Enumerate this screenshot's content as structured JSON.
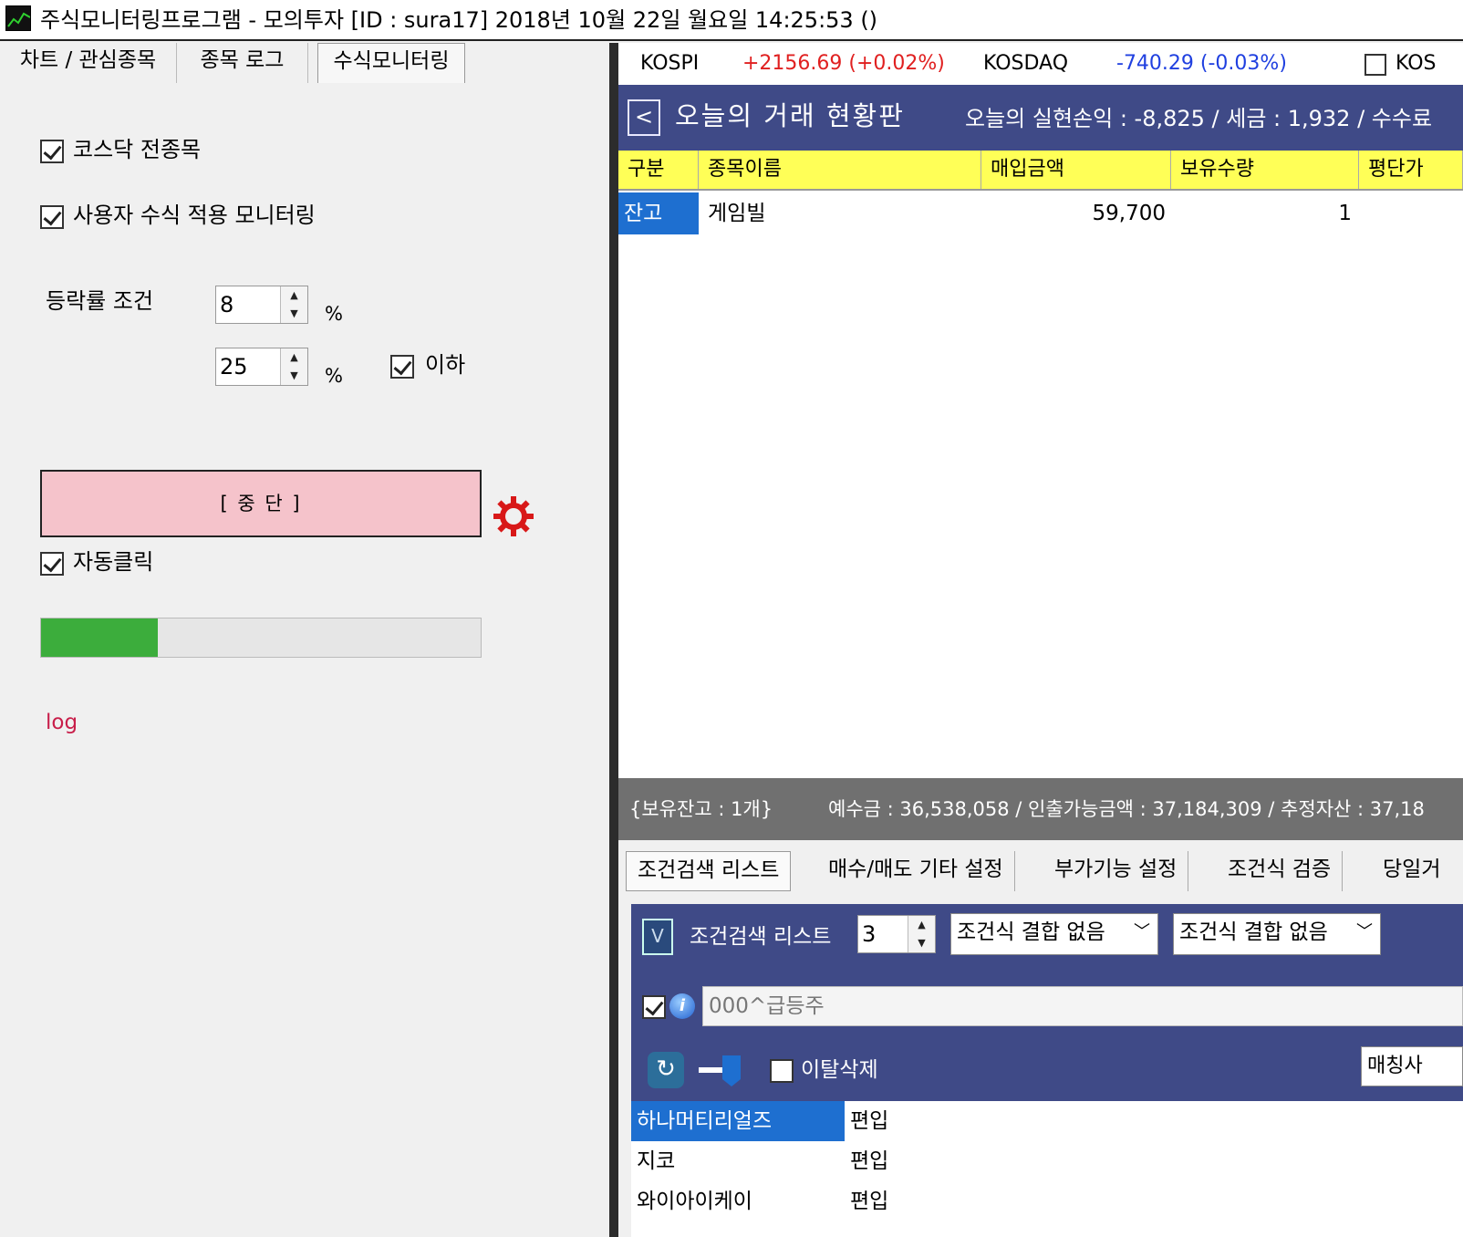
{
  "window": {
    "title": "주식모니터링프로그램 - 모의투자 [ID : sura17] 2018년 10월 22일 월요일 14:25:53 ()"
  },
  "left": {
    "tabs": [
      "차트 / 관심종목",
      "종목 로그",
      "수식모니터링"
    ],
    "active_tab": 2,
    "opt_kosdaq": "코스닥 전종목",
    "opt_formula": "사용자 수식 적용 모니터링",
    "rate_label": "등락률 조건",
    "rate_min": "8",
    "rate_max": "25",
    "percent": "%",
    "below_label": "이하",
    "stop_button": "[ 중 단 ]",
    "auto_click": "자동클릭",
    "progress": 0.265,
    "log_label": "log"
  },
  "index_bar": {
    "kospi_label": "KOSPI",
    "kospi_value": "+2156.69 (+0.02%)",
    "kosdaq_label": "KOSDAQ",
    "kosdaq_value": "-740.29 (-0.03%)",
    "extra_label": "KOS"
  },
  "board": {
    "title": "오늘의 거래 현황판",
    "summary": "오늘의 실현손익 : -8,825 / 세금 : 1,932 / 수수료",
    "back": "<",
    "columns": [
      "구분",
      "종목이름",
      "매입금액",
      "보유수량",
      "평단가"
    ],
    "rows": [
      {
        "type": "잔고",
        "name": "게임빌",
        "amount": "59,700",
        "qty": "1"
      }
    ]
  },
  "status": {
    "holding": "{보유잔고 : 1개}",
    "balance": "예수금 : 36,538,058 / 인출가능금액 : 37,184,309 / 추정자산 : 37,18"
  },
  "lower": {
    "tabs": [
      "조건검색 리스트",
      "매수/매도 기타 설정",
      "부가기능 설정",
      "조건식 검증",
      "당일거"
    ],
    "v_label": "V",
    "list_label": "조건검색 리스트",
    "list_count": "3",
    "combo1": "조건식 결합 없음",
    "combo2": "조건식 결합 없음",
    "query": "000^급등주",
    "remove_label": "이탈삭제",
    "match_button": "매칭사",
    "results": [
      {
        "name": "하나머티리얼즈",
        "status": "편입"
      },
      {
        "name": "지코",
        "status": "편입"
      },
      {
        "name": "와이아이케이",
        "status": "편입"
      }
    ]
  },
  "colors": {
    "header_blue": "#3f4a87",
    "column_yellow": "#ffff57",
    "positive": "#e02020",
    "negative": "#2040e0",
    "stop_pink": "#f5c3cb",
    "progress_green": "#3cad3c",
    "selected_blue": "#1e6fd0"
  }
}
